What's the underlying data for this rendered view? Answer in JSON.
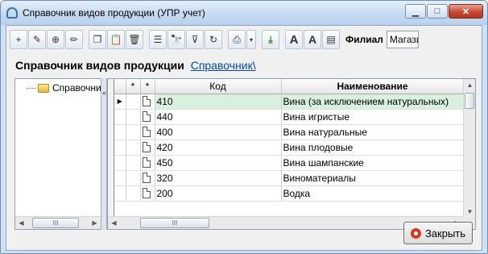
{
  "window": {
    "title": "Справочник видов продукции (УПР учет)",
    "minimize_glyph": "▁",
    "maximize_glyph": "□",
    "close_glyph": "✕"
  },
  "toolbar": {
    "buttons": [
      {
        "icon": "add-icon",
        "glyph": "+"
      },
      {
        "icon": "edit-icon",
        "glyph": "✎"
      },
      {
        "icon": "add-copy-icon",
        "glyph": "⊕"
      },
      {
        "icon": "pencil-icon",
        "glyph": "✏"
      },
      {
        "icon": "copy-icon",
        "glyph": "❐"
      },
      {
        "icon": "paste-icon",
        "glyph": "📋"
      },
      {
        "icon": "delete-icon",
        "glyph": "🗑"
      },
      {
        "icon": "list-view-icon",
        "glyph": "☰"
      },
      {
        "icon": "binoculars-icon",
        "glyph": "🔭"
      },
      {
        "icon": "filter-icon",
        "glyph": "⊽"
      },
      {
        "icon": "refresh-icon",
        "glyph": "↻"
      },
      {
        "icon": "print-icon",
        "glyph": "⎙"
      },
      {
        "icon": "export-icon",
        "glyph": "⤓"
      },
      {
        "icon": "font-increase-icon",
        "glyph": "A"
      },
      {
        "icon": "font-decrease-icon",
        "glyph": "A"
      },
      {
        "icon": "settings-icon",
        "glyph": "▤"
      }
    ],
    "print_dropdown_glyph": "▾",
    "filial_label": "Филиал",
    "filial_value": "Магазин"
  },
  "heading": {
    "title": "Справочник видов продукции",
    "link": "Справочник\\"
  },
  "tree": {
    "root_label": "Справочник",
    "scroll_thumb": "III",
    "left_arrow": "◀",
    "right_arrow": "▶"
  },
  "splitter_glyph": "«",
  "grid": {
    "columns": [
      "*",
      "*",
      "Код",
      "Наименование"
    ],
    "current_row_marker": "▶",
    "rows": [
      {
        "code": "410",
        "name": "Вина (за исключением натуральных)"
      },
      {
        "code": "440",
        "name": "Вина игристые"
      },
      {
        "code": "400",
        "name": "Вина натуральные"
      },
      {
        "code": "420",
        "name": "Вина плодовые"
      },
      {
        "code": "450",
        "name": "Вина шампанские"
      },
      {
        "code": "320",
        "name": "Виноматериалы"
      },
      {
        "code": "200",
        "name": "Водка"
      }
    ],
    "scroll_thumb": "III"
  },
  "footer": {
    "close_label": "Закрыть"
  }
}
